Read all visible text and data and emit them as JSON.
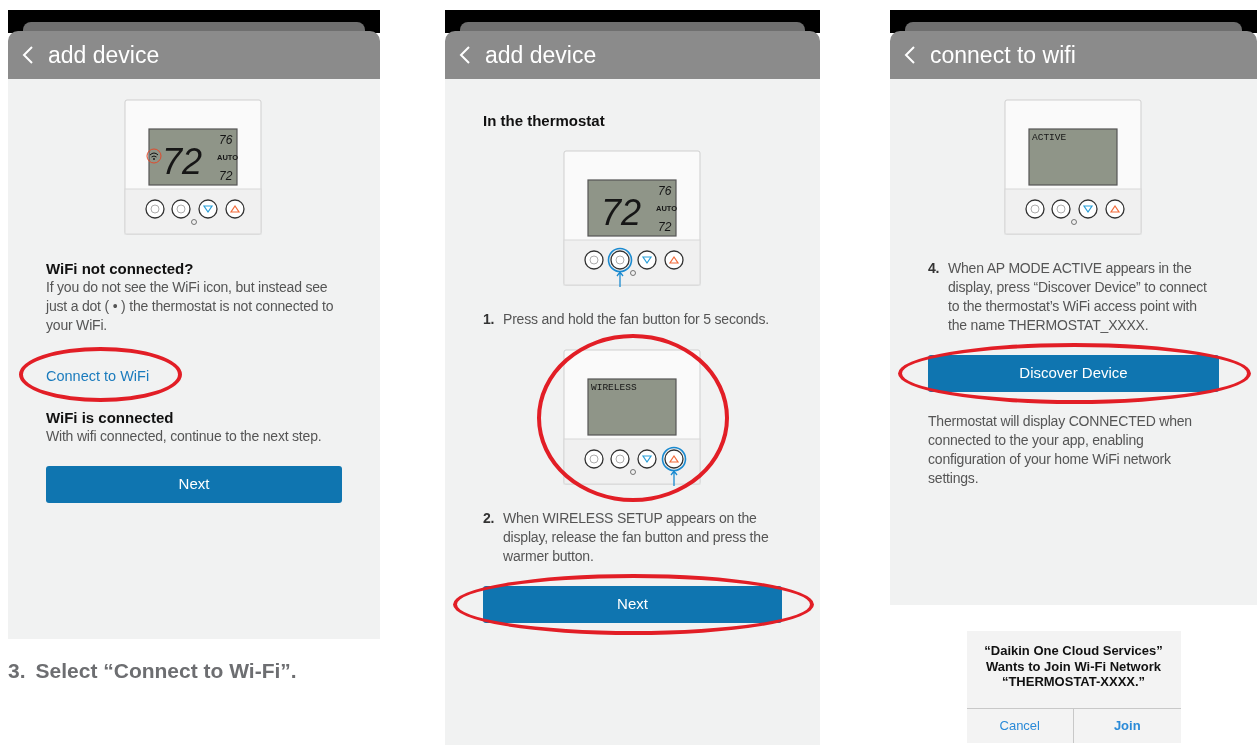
{
  "screens": [
    {
      "title": "add device",
      "body": [
        {
          "kind": "thermostat",
          "display": {
            "kind": "temps",
            "main": "72",
            "high": "76",
            "mode": "AUTO",
            "low": "72"
          },
          "wifi_icon": true,
          "buttons": [
            {
              "pressed": false
            },
            {
              "pressed": false
            },
            {
              "pressed": false
            },
            {
              "pressed": false
            }
          ],
          "circled": false
        },
        {
          "kind": "heading",
          "text": "WiFi not connected?"
        },
        {
          "kind": "paragraph",
          "text": "If you do not see the WiFi icon, but instead see just a dot ( • ) the thermostat is not connected to your WiFi."
        },
        {
          "kind": "link",
          "text": "Connect to WiFi",
          "circled": true
        },
        {
          "kind": "heading",
          "text": "WiFi is connected"
        },
        {
          "kind": "paragraph",
          "text": "With wifi connected, continue to the next step."
        },
        {
          "kind": "button",
          "text": "Next",
          "circled": false
        }
      ],
      "caption": {
        "number": "3.",
        "text": "Select “Connect to Wi-Fi”."
      }
    },
    {
      "title": "add device",
      "body": [
        {
          "kind": "heading",
          "text": "In the thermostat"
        },
        {
          "kind": "thermostat",
          "display": {
            "kind": "temps",
            "main": "72",
            "high": "76",
            "mode": "AUTO",
            "low": "72"
          },
          "wifi_icon": false,
          "buttons": [
            {
              "pressed": false
            },
            {
              "pressed": true
            },
            {
              "pressed": false
            },
            {
              "pressed": false
            }
          ],
          "circled": false
        },
        {
          "kind": "step",
          "number": "1.",
          "text": "Press and hold the fan button for 5 seconds."
        },
        {
          "kind": "thermostat",
          "display": {
            "kind": "message",
            "text": "WIRELESS"
          },
          "wifi_icon": false,
          "buttons": [
            {
              "pressed": false
            },
            {
              "pressed": false
            },
            {
              "pressed": false
            },
            {
              "pressed": true
            }
          ],
          "circled": true
        },
        {
          "kind": "step",
          "number": "2.",
          "text": "When WIRELESS SETUP appears on the display, release the fan button and press the warmer button."
        },
        {
          "kind": "button",
          "text": "Next",
          "circled": true
        }
      ]
    },
    {
      "title": "connect to wifi",
      "body": [
        {
          "kind": "thermostat",
          "display": {
            "kind": "message",
            "text": "ACTIVE"
          },
          "wifi_icon": false,
          "buttons": [
            {
              "pressed": false
            },
            {
              "pressed": false
            },
            {
              "pressed": false
            },
            {
              "pressed": false
            }
          ],
          "circled": false
        },
        {
          "kind": "step",
          "number": "4.",
          "text": "When AP MODE ACTIVE appears in the display, press “Discover Device” to connect to the thermostat’s WiFi access point with the name THERMOSTAT_XXXX."
        },
        {
          "kind": "button",
          "text": "Discover Device",
          "circled": true
        },
        {
          "kind": "paragraph",
          "text": "Thermostat will display CONNECTED when connected to the your app, enabling configuration of your home WiFi network settings."
        }
      ],
      "dialog": {
        "title_lines": [
          "“Daikin One Cloud Services”",
          "Wants to Join Wi-Fi Network",
          "“THERMOSTAT-XXXX.”"
        ],
        "buttons": [
          {
            "label": "Cancel",
            "primary": false
          },
          {
            "label": "Join",
            "primary": true
          }
        ]
      }
    }
  ]
}
